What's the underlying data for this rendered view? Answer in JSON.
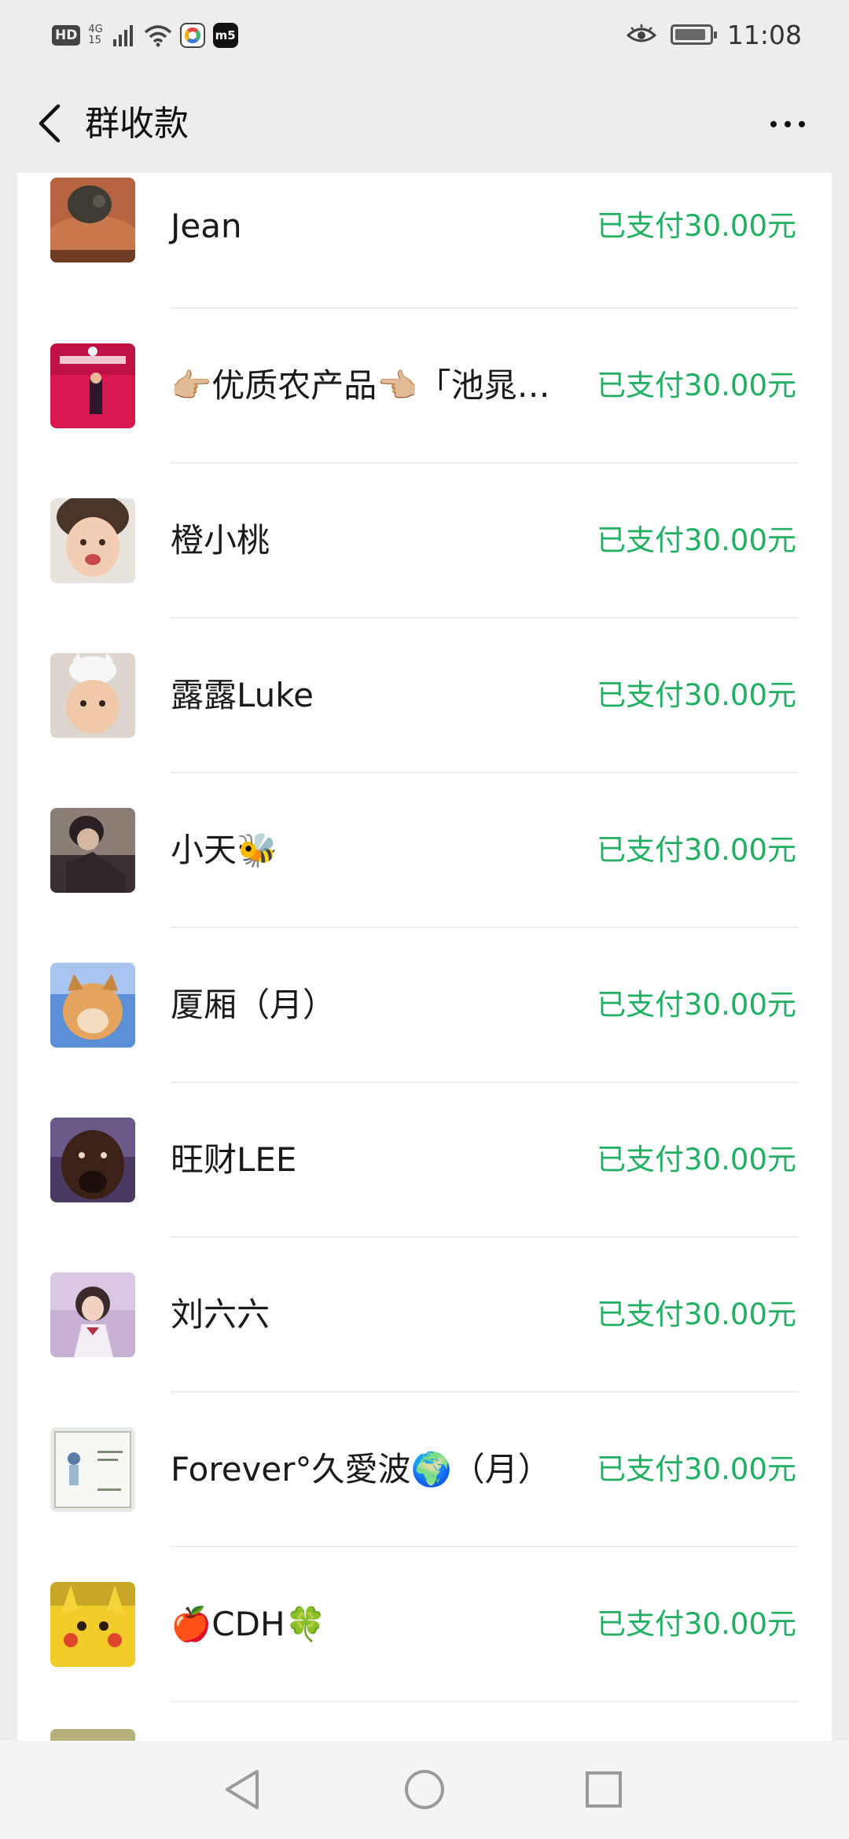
{
  "status_bar": {
    "hd_label": "HD",
    "network_label": "4G",
    "network_sub": "15",
    "app_badge": "m5",
    "time": "11:08"
  },
  "nav": {
    "title": "群收款"
  },
  "payments": [
    {
      "name": "Jean",
      "status": "已支付30.00元"
    },
    {
      "name": "👉🏼优质农产品👈🏼「池晁…",
      "status": "已支付30.00元"
    },
    {
      "name": "橙小桃",
      "status": "已支付30.00元"
    },
    {
      "name": "露露Luke",
      "status": "已支付30.00元"
    },
    {
      "name": "小天🐝",
      "status": "已支付30.00元"
    },
    {
      "name": "厦厢（月）",
      "status": "已支付30.00元"
    },
    {
      "name": "旺财LEE",
      "status": "已支付30.00元"
    },
    {
      "name": "刘六六",
      "status": "已支付30.00元"
    },
    {
      "name": "Forever°久愛波🌍（月）",
      "status": "已支付30.00元"
    },
    {
      "name": "🍎CDH🍀",
      "status": "已支付30.00元"
    }
  ],
  "icons": {
    "back": "chevron-left-icon",
    "more": "more-dots-icon",
    "sys_back": "triangle-back-icon",
    "sys_home": "circle-home-icon",
    "sys_recent": "square-recents-icon"
  },
  "colors": {
    "paid_green": "#21b062",
    "background": "#ededed",
    "card": "#ffffff"
  }
}
